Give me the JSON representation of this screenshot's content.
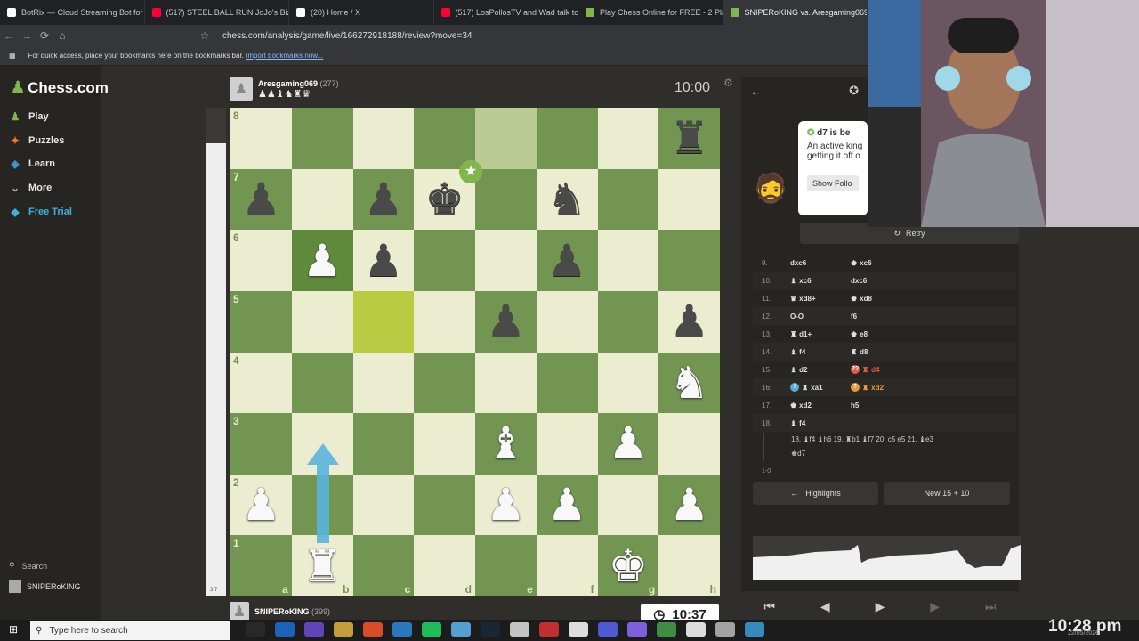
{
  "browser": {
    "tabs": [
      {
        "label": "BotRix — Cloud Streaming Bot for Tw",
        "color": "#ffffff"
      },
      {
        "label": "(517) STEEL BALL RUN JoJo's Bizarre",
        "color": "#ff0033"
      },
      {
        "label": "(20) Home / X",
        "color": "#ffffff"
      },
      {
        "label": "(517) LosPollosTV and Wad talk to u",
        "color": "#ff0033"
      },
      {
        "label": "Play Chess Online for FREE - 2 Player",
        "color": "#81b64c"
      },
      {
        "label": "SNIPERoKING vs. Aresgaming069",
        "color": "#81b64c"
      }
    ],
    "url": "chess.com/analysis/game/live/166272918188/review?move=34",
    "bookmarks_hint": "For quick access, place your bookmarks here on the bookmarks bar.",
    "bookmarks_link": "Import bookmarks now..."
  },
  "sidebar": {
    "logo": "Chess.com",
    "items": [
      {
        "label": "Play",
        "icon": "play-icon",
        "color": "#81b64c"
      },
      {
        "label": "Puzzles",
        "icon": "puzzle-icon",
        "color": "#f7771b"
      },
      {
        "label": "Learn",
        "icon": "learn-icon",
        "color": "#3aa0d8"
      },
      {
        "label": "More",
        "icon": "chevron-down-icon",
        "color": "#aaaaaa"
      },
      {
        "label": "Free Trial",
        "icon": "diamond-icon",
        "color": "#3fb0e0"
      }
    ],
    "search": "Search",
    "user": "SNIPERoKING"
  },
  "game": {
    "top_player": {
      "name": "Aresgaming069",
      "rating": "(277)",
      "captured": "♟♟♝♞♜♛"
    },
    "bottom_player": {
      "name": "SNIPERoKING",
      "rating": "(399)"
    },
    "top_clock": "10:00",
    "bottom_clock": "10:37",
    "eval_label": "3.7",
    "ranks": [
      "8",
      "7",
      "6",
      "5",
      "4",
      "3",
      "2",
      "1"
    ],
    "files": [
      "a",
      "b",
      "c",
      "d",
      "e",
      "f",
      "g",
      "h"
    ],
    "board": [
      [
        "",
        "",
        "",
        "",
        "",
        "",
        "",
        "r"
      ],
      [
        "p",
        "",
        "p",
        "k",
        "",
        "n",
        "",
        ""
      ],
      [
        "",
        "P",
        "p",
        "",
        "",
        "p",
        "",
        ""
      ],
      [
        "",
        "",
        "",
        "",
        "p",
        "",
        "",
        "p"
      ],
      [
        "",
        "",
        "",
        "",
        "",
        "",
        "",
        "N"
      ],
      [
        "",
        "",
        "",
        "",
        "B",
        "",
        "P",
        ""
      ],
      [
        "P",
        "",
        "",
        "",
        "P",
        "P",
        "",
        "P"
      ],
      [
        "",
        "R",
        "",
        "",
        "",
        "",
        "K",
        ""
      ]
    ],
    "highlights": [
      "e8",
      "c5"
    ]
  },
  "panel": {
    "coach_title": "d7 is be",
    "coach_text_1": "An active king",
    "coach_text_2": "getting it off o",
    "show_follow": "Show Follo",
    "retry": "Retry",
    "moves": [
      {
        "n": "9.",
        "w": "dxc6",
        "b": "xc6",
        "bp": "♚"
      },
      {
        "n": "10.",
        "w": "xc6",
        "wp": "♝",
        "b": "dxc6"
      },
      {
        "n": "11.",
        "w": "xd8+",
        "wp": "♛",
        "b": "xd8",
        "bp": "♚"
      },
      {
        "n": "12.",
        "w": "O-O",
        "b": "f6"
      },
      {
        "n": "13.",
        "w": "d1+",
        "wp": "♜",
        "b": "e8",
        "bp": "♚"
      },
      {
        "n": "14.",
        "w": "f4",
        "wp": "♝",
        "b": "d8",
        "bp": "♜"
      },
      {
        "n": "15.",
        "w": "d2",
        "wp": "♝",
        "b": "d4",
        "bp": "♜",
        "bflag": "??",
        "bclass": "red"
      },
      {
        "n": "16.",
        "w": "xa1",
        "wp": "♜",
        "wflag": "!",
        "b": "xd2",
        "bp": "♜",
        "bflag2": "?",
        "bclass": "orange"
      },
      {
        "n": "17.",
        "w": "xd2",
        "wp": "♚",
        "b": "h5"
      },
      {
        "n": "18.",
        "w": "f4",
        "wp": "♝",
        "b": ""
      }
    ],
    "variation": "18. ♝f4 ♝h6 19. ♜b1 ♝f7 20. c5 e5 21. ♝e3",
    "variation_end": "♚d7",
    "result": "1-0",
    "highlights_btn": "Highlights",
    "new_btn": "New 15 + 10"
  },
  "taskbar": {
    "search_placeholder": "Type here to search",
    "time": "10:28 pm",
    "date": "22/05/2026"
  }
}
